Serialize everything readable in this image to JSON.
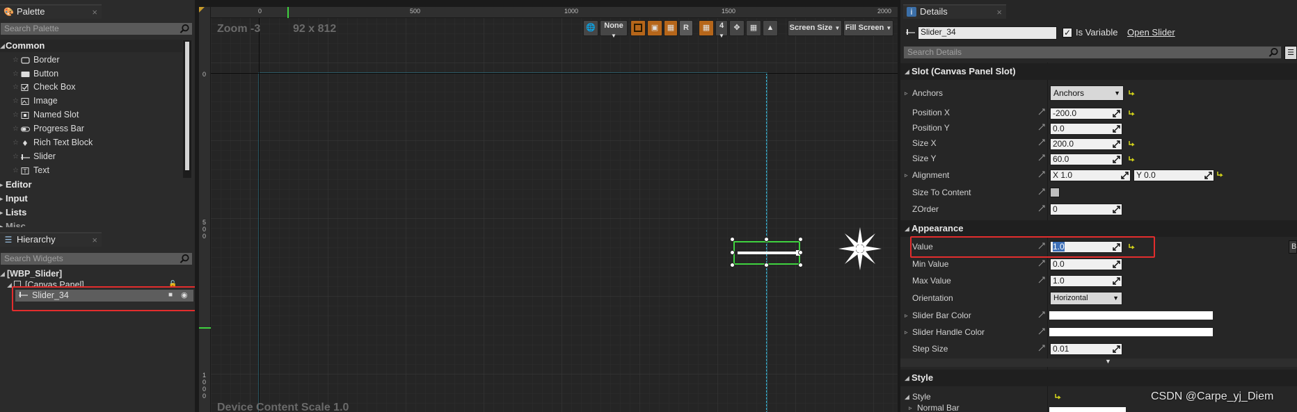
{
  "palette": {
    "tab_title": "Palette",
    "search_placeholder": "Search Palette",
    "categories": [
      "Common",
      "Editor",
      "Input",
      "Lists",
      "Misc"
    ],
    "common_items": [
      {
        "label": "Border",
        "icon": "border-icon"
      },
      {
        "label": "Button",
        "icon": "button-icon"
      },
      {
        "label": "Check Box",
        "icon": "checkbox-icon"
      },
      {
        "label": "Image",
        "icon": "image-icon"
      },
      {
        "label": "Named Slot",
        "icon": "named-slot-icon"
      },
      {
        "label": "Progress Bar",
        "icon": "progress-bar-icon"
      },
      {
        "label": "Rich Text Block",
        "icon": "rich-text-icon"
      },
      {
        "label": "Slider",
        "icon": "slider-icon"
      },
      {
        "label": "Text",
        "icon": "text-icon"
      }
    ]
  },
  "hierarchy": {
    "tab_title": "Hierarchy",
    "search_placeholder": "Search Widgets",
    "root": "[WBP_Slider]",
    "canvas": "[Canvas Panel]",
    "selected": "Slider_34"
  },
  "viewport": {
    "zoom_label": "Zoom -3",
    "resolution": "92 x 812",
    "bottom_label": "Device Content Scale 1.0",
    "ruler_top": [
      "0",
      "500",
      "1000",
      "1500",
      "2000"
    ],
    "ruler_left": [
      "0",
      "500",
      "1000"
    ],
    "toolbar": {
      "none_label": "None",
      "r_label": "R",
      "grid_count": "4",
      "screen_size": "Screen Size",
      "fill_screen": "Fill Screen"
    }
  },
  "details": {
    "tab_title": "Details",
    "widget_name": "Slider_34",
    "is_variable_label": "Is Variable",
    "is_variable_checked": true,
    "open_label": "Open Slider",
    "search_placeholder": "Search Details",
    "slot_section": "Slot (Canvas Panel Slot)",
    "anchors_label": "Anchors",
    "anchors_value": "Anchors",
    "position_x_label": "Position X",
    "position_x": "-200.0",
    "position_y_label": "Position Y",
    "position_y": "0.0",
    "size_x_label": "Size X",
    "size_x": "200.0",
    "size_y_label": "Size Y",
    "size_y": "60.0",
    "alignment_label": "Alignment",
    "alignment_x": "X  1.0",
    "alignment_y": "Y  0.0",
    "size_to_content_label": "Size To Content",
    "zorder_label": "ZOrder",
    "zorder": "0",
    "appearance_section": "Appearance",
    "value_label": "Value",
    "value": "1.0",
    "min_value_label": "Min Value",
    "min_value": "0.0",
    "max_value_label": "Max Value",
    "max_value": "1.0",
    "orientation_label": "Orientation",
    "orientation": "Horizontal",
    "bar_color_label": "Slider Bar Color",
    "handle_color_label": "Slider Handle Color",
    "step_size_label": "Step Size",
    "step_size": "0.01",
    "style_section": "Style",
    "style_label": "Style",
    "normal_bar_label": "Normal Bar",
    "side_button": "B"
  },
  "watermark": "CSDN @Carpe_yj_Diem",
  "colors": {
    "accent_orange": "#b6661a",
    "selection_green": "#3fd33f",
    "canvas_outline": "#3ab6d8",
    "highlight_red": "#e32d2d"
  }
}
